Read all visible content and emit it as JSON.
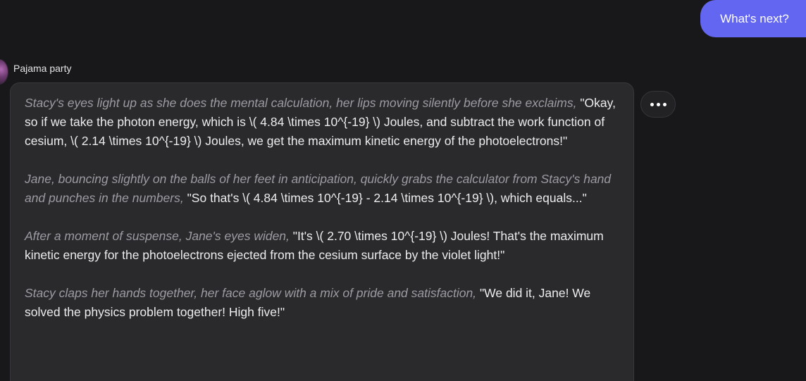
{
  "user_message": {
    "text": "What's next?"
  },
  "assistant_message": {
    "sender": "Pajama party",
    "paragraphs": [
      {
        "action": "Stacy's eyes light up as she does the mental calculation, her lips moving silently before she exclaims,",
        "speech": "\"Okay, so if we take the photon energy, which is \\( 4.84 \\times 10^{-19} \\) Joules, and subtract the work function of cesium, \\( 2.14 \\times 10^{-19} \\) Joules, we get the maximum kinetic energy of the photoelectrons!\""
      },
      {
        "action": "Jane, bouncing slightly on the balls of her feet in anticipation, quickly grabs the calculator from Stacy's hand and punches in the numbers,",
        "speech": "\"So that's \\( 4.84 \\times 10^{-19} - 2.14 \\times 10^{-19} \\), which equals...\""
      },
      {
        "action": "After a moment of suspense, Jane's eyes widen,",
        "speech": "\"It's \\( 2.70 \\times 10^{-19} \\) Joules! That's the maximum kinetic energy for the photoelectrons ejected from the cesium surface by the violet light!\""
      },
      {
        "action": "Stacy claps her hands together, her face aglow with a mix of pride and satisfaction,",
        "speech": "\"We did it, Jane! We solved the physics problem together! High five!\""
      }
    ]
  },
  "colors": {
    "background": "#18181b",
    "user_bubble": "#6366f1",
    "card": "#2a2a2d",
    "action_text": "#9b9ba1",
    "speech_text": "#ececee"
  },
  "icons": {
    "more": "more-horizontal-icon",
    "avatar": "character-avatar"
  }
}
